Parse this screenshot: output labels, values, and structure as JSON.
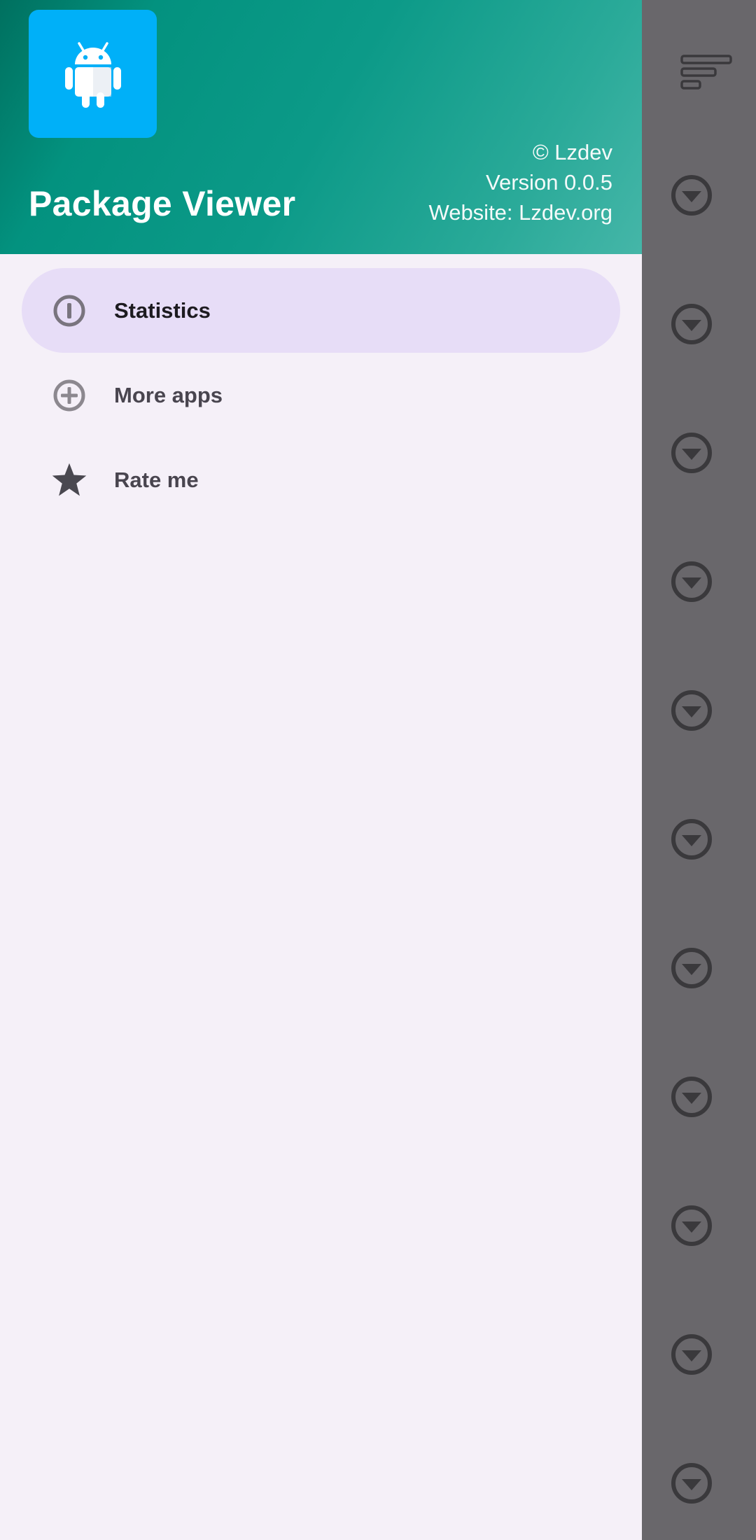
{
  "header": {
    "app_title": "Package Viewer",
    "copyright": "© Lzdev",
    "version": "Version 0.0.5",
    "website": "Website: Lzdev.org",
    "app_icon": "android-icon"
  },
  "menu": {
    "items": [
      {
        "label": "Statistics",
        "icon": "info-icon",
        "active": true
      },
      {
        "label": "More apps",
        "icon": "add-circle-icon",
        "active": false
      },
      {
        "label": "Rate me",
        "icon": "star-icon",
        "active": false
      }
    ]
  },
  "background": {
    "sort_icon": "sort-icon",
    "row_icon": "expand-circle-icon",
    "row_count": 11
  },
  "colors": {
    "header_gradient_start": "#00705f",
    "header_gradient_end": "#45b6a8",
    "app_icon_bg": "#00b0f8",
    "active_item_bg": "#e7ddf7",
    "drawer_bg": "#f5f0f8",
    "scrim": "#69676b"
  }
}
